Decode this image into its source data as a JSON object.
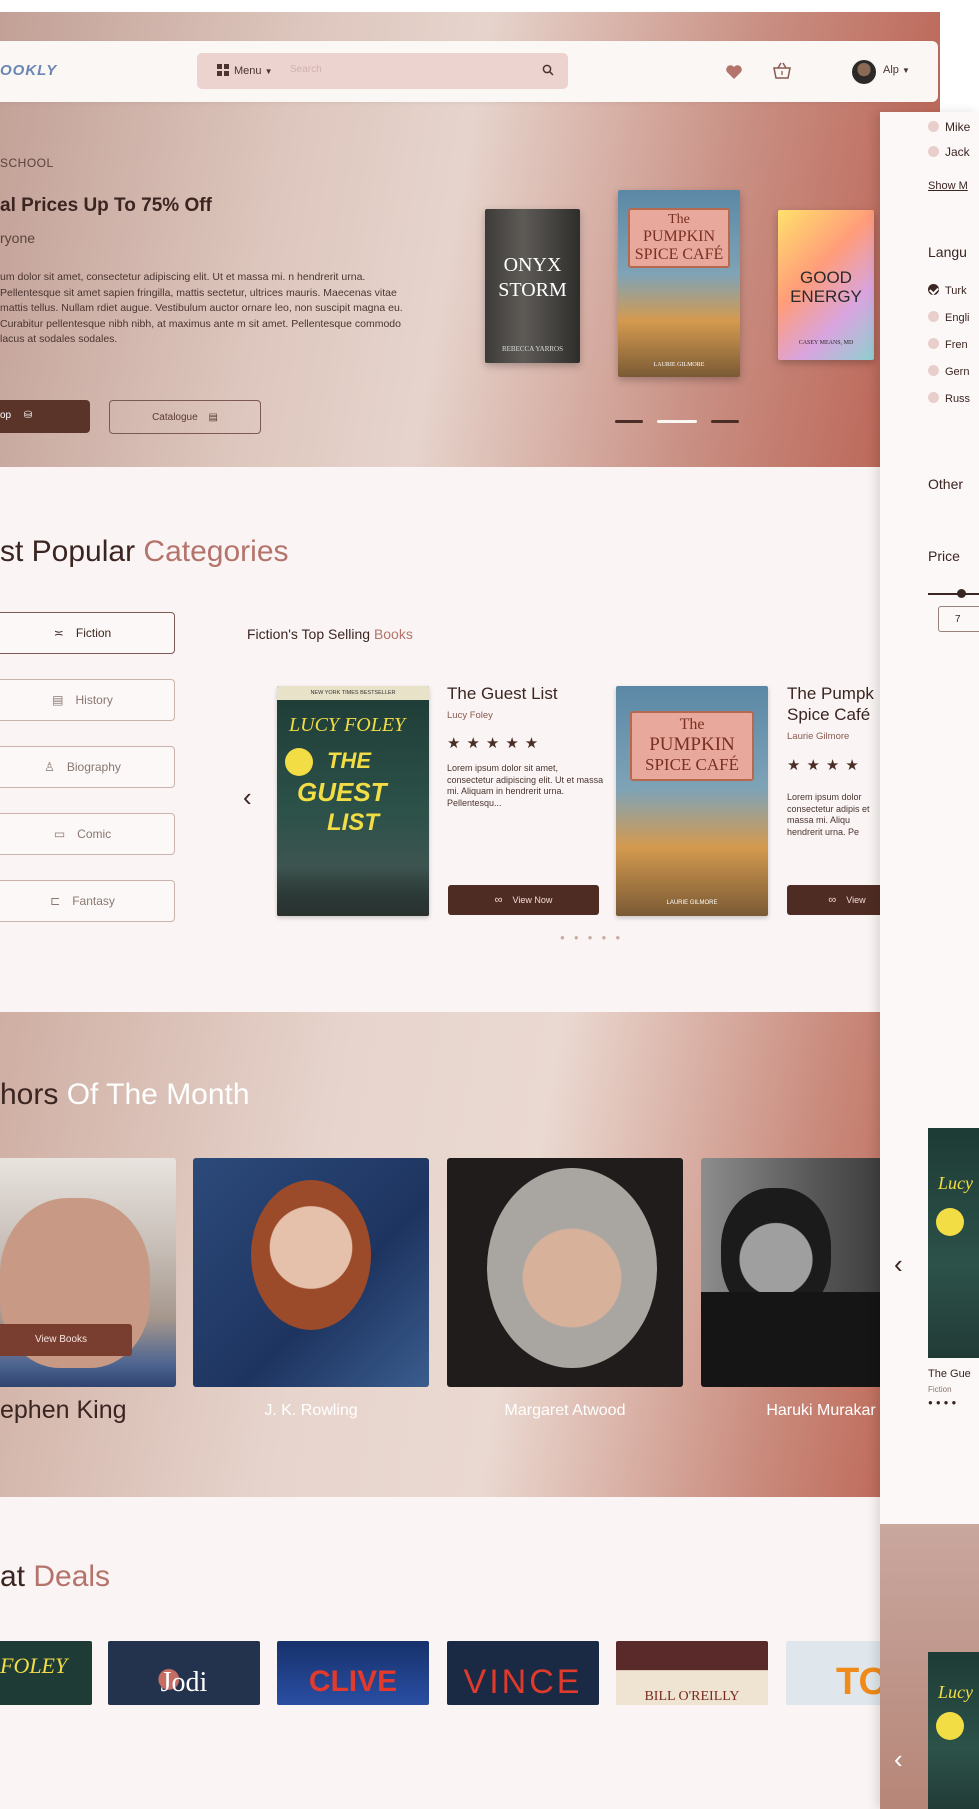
{
  "colors": {
    "accent": "#b4736b",
    "brand_dark": "#4f2c23",
    "search_bg": "#ecd3cf",
    "logo": "#6a86b4"
  },
  "nav": {
    "logo": "OOKLY",
    "menu_label": "Menu",
    "search_placeholder": "Search",
    "icons": [
      "heart-icon",
      "basket-icon",
      "search-icon"
    ],
    "user_name": "Alp"
  },
  "hero": {
    "kicker": "SCHOOL",
    "title": "al Prices Up To 75% Off",
    "subtitle": "ryone",
    "body": "um dolor sit amet, consectetur adipiscing elit. Ut et massa mi. n hendrerit urna. Pellentesque sit amet sapien fringilla, mattis sectetur, ultrices mauris. Maecenas vitae mattis tellus. Nullam rdiet augue. Vestibulum auctor ornare leo, non suscipit magna eu. Curabitur pellentesque nibh nibh, at maximus ante m sit amet. Pellentesque commodo lacus at sodales sodales.",
    "shop_label": "op",
    "catalogue_label": "Catalogue",
    "books": [
      {
        "line1": "ONYX",
        "line2": "STORM",
        "author": "REBECCA YARROS"
      },
      {
        "line1": "The",
        "line2": "PUMPKIN",
        "line3": "SPICE CAFÉ",
        "author": "LAURIE GILMORE"
      },
      {
        "line1": "GOOD",
        "line2": "ENERGY",
        "author": "CASEY MEANS, MD"
      }
    ],
    "slide_count": 3,
    "active_slide": 2
  },
  "categories": {
    "title_plain": "st Popular ",
    "title_accent": "Categories",
    "items": [
      "Fiction",
      "History",
      "Biography",
      "Comic",
      "Fantasy"
    ],
    "active": "Fiction",
    "subhead_plain": "Fiction's Top Selling ",
    "subhead_accent": "Books",
    "books": [
      {
        "title": "The Guest List",
        "author": "Lucy Foley",
        "rating": 5,
        "desc": "Lorem ipsum dolor sit amet, consectetur adipiscing elit. Ut et massa mi. Aliquam in hendrerit urna. Pellentesqu...",
        "button": "View Now",
        "cover_line1": "LUCY FOLEY",
        "cover_line2": "THE",
        "cover_line3": "GUEST",
        "cover_line4": "LIST",
        "cover_banner": "NEW YORK TIMES BESTSELLER"
      },
      {
        "title": "The Pumpk",
        "title2": "Spice Café",
        "author": "Laurie Gilmore",
        "rating": 4,
        "desc": "Lorem ipsum dolor consectetur adipis et massa mi. Aliqu hendrerit urna. Pe",
        "button": "View",
        "cover_line1": "The",
        "cover_line2": "PUMPKIN",
        "cover_line3": "SPICE CAFÉ",
        "cover_author": "LAURIE GILMORE"
      }
    ],
    "pager_count": 5
  },
  "authors": {
    "title_plain": "hors ",
    "title_accent": "Of The Month",
    "items": [
      {
        "name": "ephen King",
        "button": "View Books"
      },
      {
        "name": "J. K. Rowling"
      },
      {
        "name": "Margaret Atwood"
      },
      {
        "name": "Haruki Murakar"
      }
    ]
  },
  "deals": {
    "title_plain": "at ",
    "title_accent": "Deals",
    "items": [
      {
        "cover": "FOLEY"
      },
      {
        "cover": "Jodi"
      },
      {
        "cover": "CLIVE"
      },
      {
        "cover": "VINCE"
      },
      {
        "cover": "BILL O'REILLY"
      },
      {
        "cover": "TO"
      }
    ]
  },
  "filter_panel": {
    "authors": [
      "Mike",
      "Jack"
    ],
    "show_more": "Show M",
    "language_heading": "Langu",
    "languages": [
      {
        "label": "Turk",
        "checked": true
      },
      {
        "label": "Engli",
        "checked": false
      },
      {
        "label": "Fren",
        "checked": false
      },
      {
        "label": "Gern",
        "checked": false
      },
      {
        "label": "Russ",
        "checked": false
      }
    ],
    "other_heading": "Other",
    "price_heading": "Price",
    "price_min": "7",
    "result_title": "The Gue",
    "result_genre": "Fiction"
  }
}
